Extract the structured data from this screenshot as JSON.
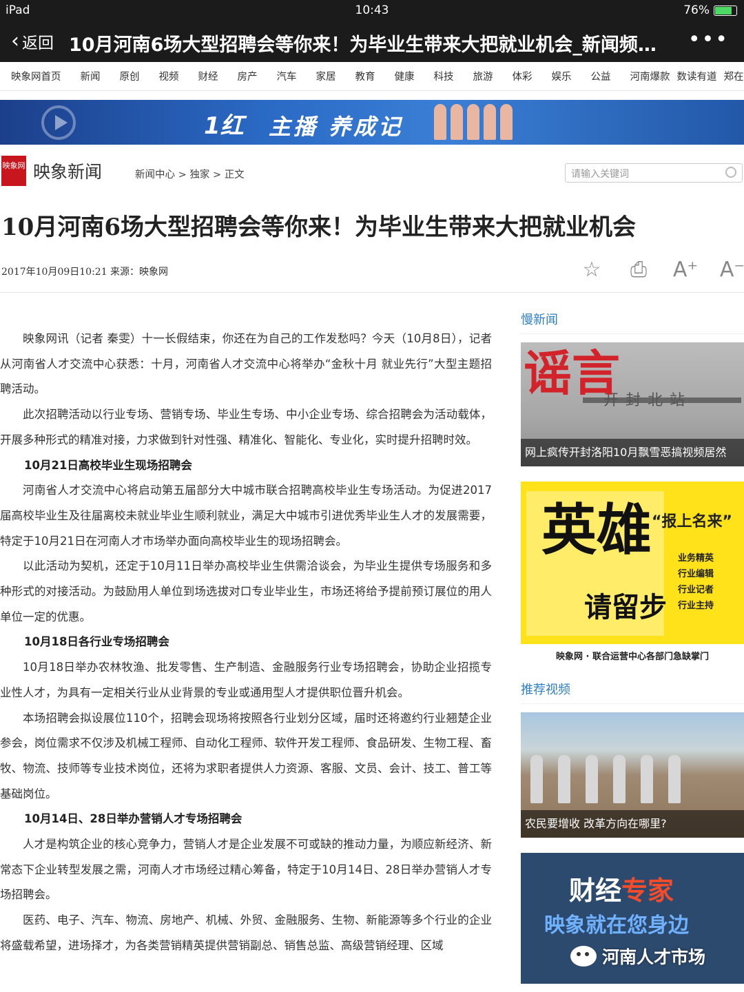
{
  "status": {
    "device": "iPad",
    "time": "10:43",
    "battery": "76%",
    "battery_level": 0.76
  },
  "nav": {
    "back": "返回",
    "title": "10月河南6场大型招聘会等你来！为毕业生带来大把就业机会_新闻频…",
    "more": "•••"
  },
  "channels": [
    "映象网首页",
    "新闻",
    "原创",
    "视频",
    "财经",
    "房产",
    "汽车",
    "家居",
    "教育",
    "健康",
    "科技",
    "旅游",
    "体彩",
    "娱乐",
    "公益",
    "河南爆款",
    "数读有道",
    "郑在读书"
  ],
  "banner": {
    "logo": "1红",
    "text": "主播 养成记"
  },
  "site": {
    "logo_text": "映象网",
    "name": "映象新闻",
    "breadcrumb": "新闻中心 > 独家 > 正文"
  },
  "search": {
    "placeholder": "请输入关键词"
  },
  "article": {
    "title": "10月河南6场大型招聘会等你来！为毕业生带来大把就业机会",
    "meta": "2017年10月09日10:21  来源：映象网",
    "tools": [
      "☆",
      "⎙",
      "A⁺",
      "A⁻"
    ],
    "p1": "映象网讯（记者 秦雯）十一长假结束，你还在为自己的工作发愁吗？今天（10月8日），记者从河南省人才交流中心获悉：十月，河南省人才交流中心将举办“金秋十月 就业先行”大型主题招聘活动。",
    "p2": "此次招聘活动以行业专场、营销专场、毕业生专场、中小企业专场、综合招聘会为活动载体，开展多种形式的精准对接，力求做到针对性强、精准化、智能化、专业化，实时提升招聘时效。",
    "h_a": "10月21日高校毕业生现场招聘会",
    "p3": "河南省人才交流中心将启动第五届部分大中城市联合招聘高校毕业生专场活动。为促进2017届高校毕业生及往届离校未就业毕业生顺利就业，满足大中城市引进优秀毕业生人才的发展需要，特定于10月21日在河南人才市场举办面向高校毕业生的现场招聘会。",
    "p4": "以此活动为契机，还定于10月11日举办高校毕业生供需洽谈会，为毕业生提供专场服务和多种形式的对接活动。为鼓励用人单位到场选拔对口专业毕业生，市场还将给予提前预订展位的用人单位一定的优惠。",
    "h_b": "10月18日各行业专场招聘会",
    "p5": "10月18日举办农林牧渔、批发零售、生产制造、金融服务行业专场招聘会，协助企业招揽专业性人才，为具有一定相关行业从业背景的专业或通用型人才提供职位晋升机会。",
    "p6": "本场招聘会拟设展位110个，招聘会现场将按照各行业划分区域，届时还将邀约行业翘楚企业参会，岗位需求不仅涉及机械工程师、自动化工程师、软件开发工程师、食品研发、生物工程、畜牧、物流、技师等专业技术岗位，还将为求职者提供人力资源、客服、文员、会计、技工、普工等基础岗位。",
    "h_c": "10月14日、28日举办营销人才专场招聘会",
    "p7": "人才是构筑企业的核心竞争力，营销人才是企业发展不可或缺的推动力量，为顺应新经济、新常态下企业转型发展之需，河南人才市场经过精心筹备，特定于10月14日、28日举办营销人才专场招聘会。",
    "p8": "医药、电子、汽车、物流、房地产、机械、外贸、金融服务、生物、新能源等多个行业的企业将盛载希望，进场择才，为各类营销精英提供营销副总、销售总监、高级营销经理、区域"
  },
  "sidebar": {
    "sec1": "慢新闻",
    "t1_overlay": "谣言",
    "t1_sign": "开封北站",
    "t1_caption": "网上疯传开封洛阳10月飘雪恶搞视频居然",
    "ad_hero": "英雄",
    "ad_stay": "请留步",
    "ad_title": "“报上名来”",
    "ad_roles": [
      "业务精英",
      "行业编辑",
      "行业记者",
      "行业主持"
    ],
    "ad_foot": "映象网 · 联合运营中心各部门急缺掌门",
    "sec2": "推荐视频",
    "t3_caption": "农民要增收 改革方向在哪里?",
    "t4_a1": "财经",
    "t4_a2": "专家",
    "t4_b": "映象就在您身边"
  },
  "watermark": "河南人才市场"
}
